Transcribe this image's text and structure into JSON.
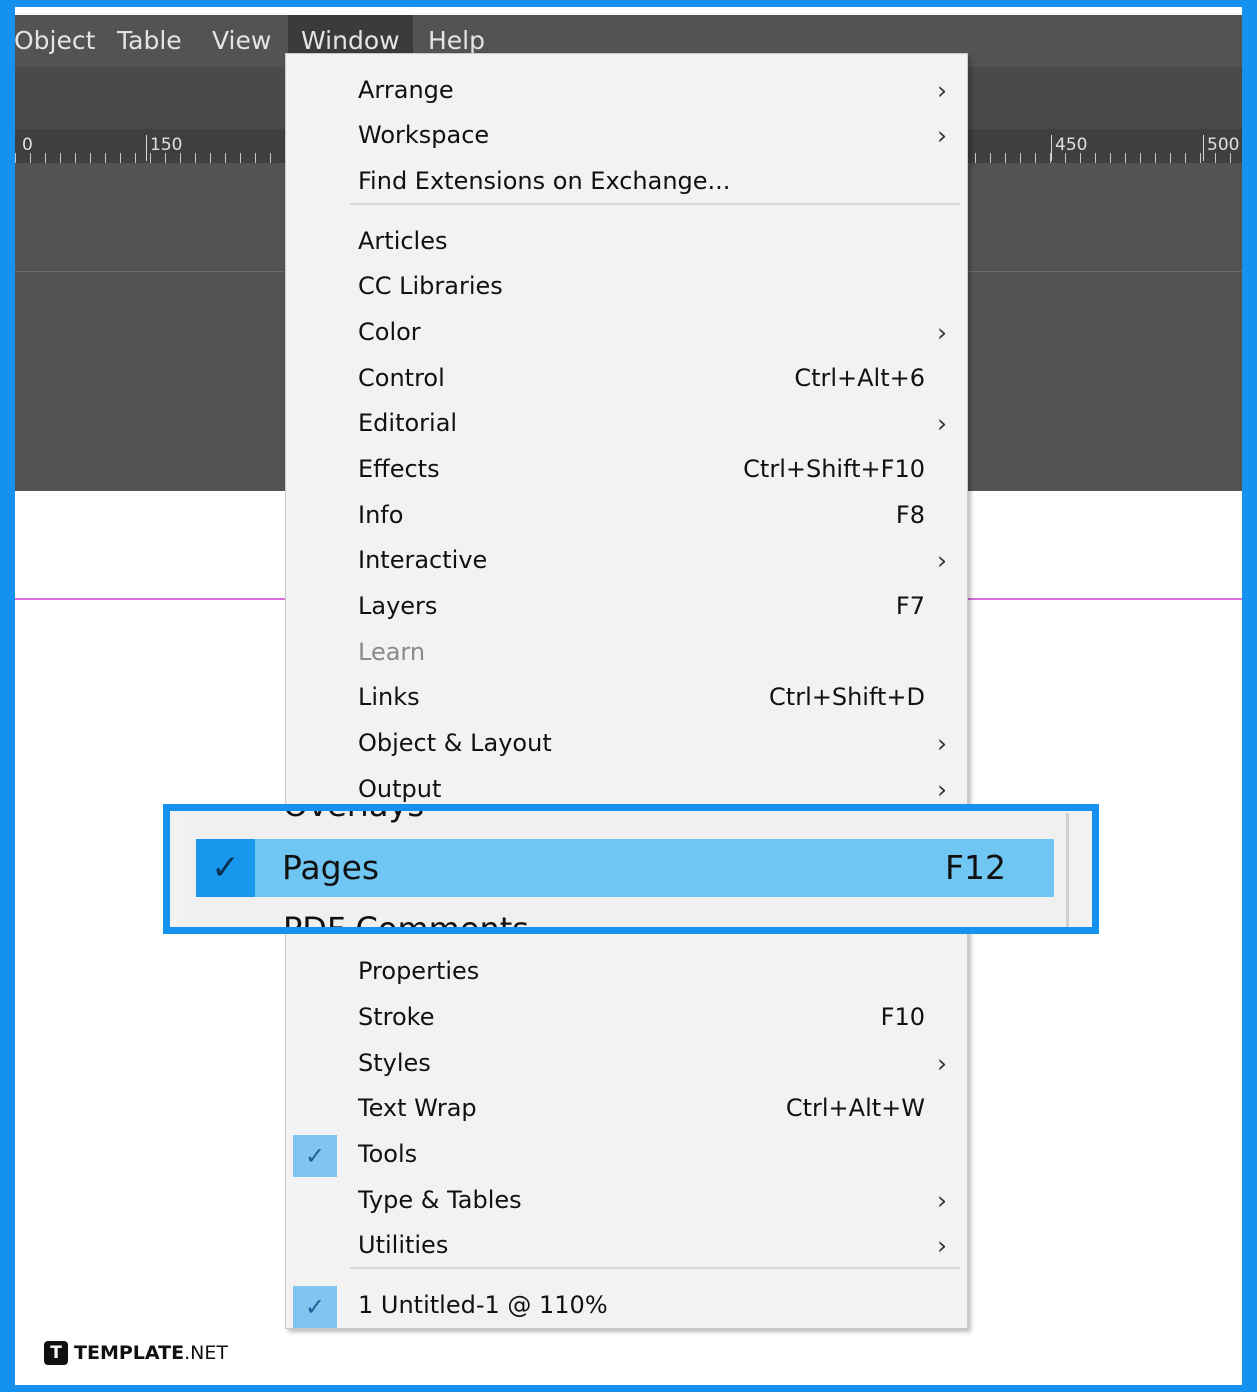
{
  "menubar": {
    "items": [
      {
        "label": "Object"
      },
      {
        "label": "Table"
      },
      {
        "label": "View"
      },
      {
        "label": "Window",
        "active": true
      },
      {
        "label": "Help"
      }
    ]
  },
  "ruler": {
    "labels": [
      "0",
      "150",
      "450",
      "500"
    ]
  },
  "window_menu": {
    "items": [
      {
        "label": "Arrange",
        "submenu": true
      },
      {
        "label": "Workspace",
        "submenu": true
      },
      {
        "label": "Find Extensions on Exchange..."
      },
      {
        "separator": true
      },
      {
        "label": "Articles"
      },
      {
        "label": "CC Libraries"
      },
      {
        "label": "Color",
        "submenu": true
      },
      {
        "label": "Control",
        "shortcut": "Ctrl+Alt+6"
      },
      {
        "label": "Editorial",
        "submenu": true
      },
      {
        "label": "Effects",
        "shortcut": "Ctrl+Shift+F10"
      },
      {
        "label": "Info",
        "shortcut": "F8"
      },
      {
        "label": "Interactive",
        "submenu": true
      },
      {
        "label": "Layers",
        "shortcut": "F7"
      },
      {
        "label": "Learn",
        "disabled": true
      },
      {
        "label": "Links",
        "shortcut": "Ctrl+Shift+D"
      },
      {
        "label": "Object & Layout",
        "submenu": true
      },
      {
        "label": "Output",
        "submenu": true
      },
      {
        "label": "Properties"
      },
      {
        "label": "Stroke",
        "shortcut": "F10"
      },
      {
        "label": "Styles",
        "submenu": true
      },
      {
        "label": "Text Wrap",
        "shortcut": "Ctrl+Alt+W"
      },
      {
        "label": "Tools",
        "checked": true
      },
      {
        "label": "Type & Tables",
        "submenu": true
      },
      {
        "label": "Utilities",
        "submenu": true
      },
      {
        "separator": true
      },
      {
        "label": "1 Untitled-1 @ 110%",
        "checked": true
      }
    ],
    "arrow_glyph": "›",
    "check_glyph": "✓"
  },
  "zoom_callout": {
    "above_label": "Overlays",
    "highlighted": {
      "label": "Pages",
      "shortcut": "F12",
      "checked": true
    },
    "below_label": "PDF Comments"
  },
  "brand": {
    "bold": "TEMPLATE",
    "regular": ".NET",
    "logo": "T"
  },
  "colors": {
    "highlight_frame": "#1591f0",
    "menu_bg": "#f2f2f2",
    "selected_row": "#70c6f2",
    "check_bg": "#1997ec",
    "margin_guide": "#d96fdc",
    "app_dark": "#535353"
  }
}
